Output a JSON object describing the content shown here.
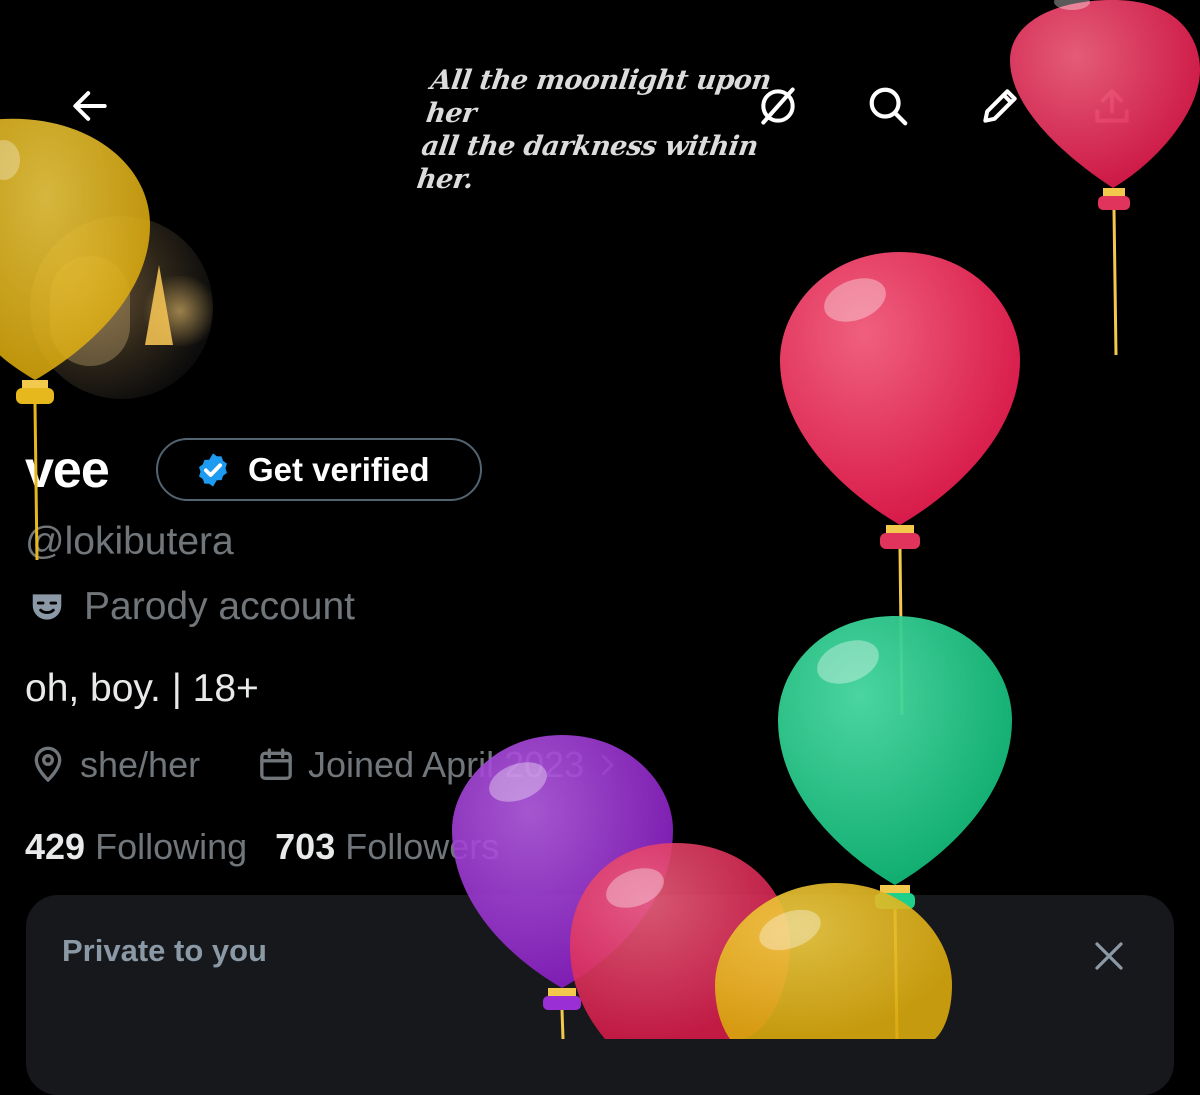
{
  "header": {
    "banner_quote_line1": "All the moonlight upon her",
    "banner_quote_line2": "all the darkness within her.",
    "icons": [
      "back-arrow-icon",
      "grok-icon",
      "search-icon",
      "edit-icon",
      "share-icon"
    ]
  },
  "profile": {
    "display_name": "vee",
    "verify_button_label": "Get verified",
    "handle": "@lokibutera",
    "parody_label": "Parody account",
    "bio": "oh, boy. | 18+",
    "pronouns": "she/her",
    "joined": "Joined April 2023",
    "following_count": "429",
    "following_label": "Following",
    "followers_count": "703",
    "followers_label": "Followers"
  },
  "private_card": {
    "title": "Private to you"
  },
  "colors": {
    "background": "#000000",
    "verified_blue": "#1d9bf0",
    "muted_text": "#71767b",
    "balloon_red": "#e0345c",
    "balloon_yellow": "#e7b81e",
    "balloon_green": "#1fcf8c",
    "balloon_purple": "#9b2fd6"
  }
}
